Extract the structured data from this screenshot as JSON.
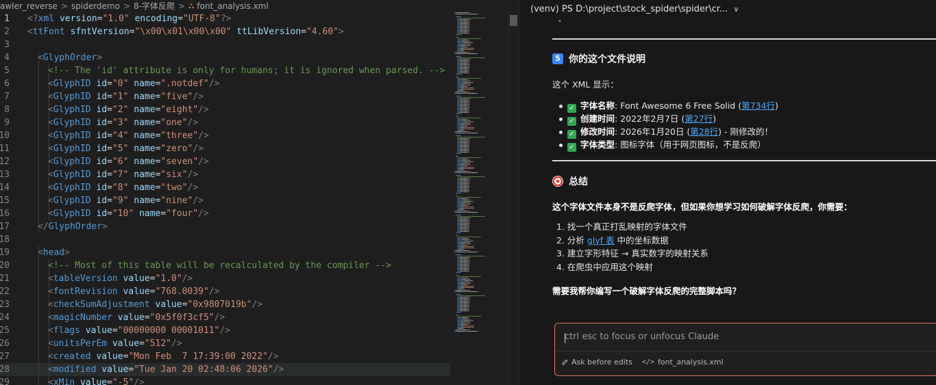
{
  "breadcrumb": {
    "items": [
      "awler_reverse",
      "spiderdemo",
      "8-字体反爬"
    ],
    "file_icon": "rss-icon",
    "file_name": "font_analysis.xml"
  },
  "editor": {
    "language": "xml",
    "current_line": 1,
    "lines": [
      {
        "n": "1",
        "indent": 0,
        "tokens": [
          [
            "punc",
            "<?"
          ],
          [
            "tag",
            "xml"
          ],
          [
            "text",
            " "
          ],
          [
            "attr",
            "version"
          ],
          [
            "text",
            "="
          ],
          [
            "str",
            "\"1.0\""
          ],
          [
            "text",
            " "
          ],
          [
            "attr",
            "encoding"
          ],
          [
            "text",
            "="
          ],
          [
            "str",
            "\"UTF-8\""
          ],
          [
            "punc",
            "?>"
          ]
        ]
      },
      {
        "n": "2",
        "indent": 0,
        "tokens": [
          [
            "punc",
            "<"
          ],
          [
            "tag",
            "ttFont"
          ],
          [
            "text",
            " "
          ],
          [
            "attr",
            "sfntVersion"
          ],
          [
            "text",
            "="
          ],
          [
            "str",
            "\"\\x00\\x01\\x00\\x00\""
          ],
          [
            "text",
            " "
          ],
          [
            "attr",
            "ttLibVersion"
          ],
          [
            "text",
            "="
          ],
          [
            "str",
            "\"4.60\""
          ],
          [
            "punc",
            ">"
          ]
        ]
      },
      {
        "n": "3",
        "indent": 0,
        "tokens": []
      },
      {
        "n": "4",
        "indent": 1,
        "tokens": [
          [
            "punc",
            "<"
          ],
          [
            "tag",
            "GlyphOrder"
          ],
          [
            "punc",
            ">"
          ]
        ]
      },
      {
        "n": "5",
        "indent": 2,
        "tokens": [
          [
            "cmt",
            "<!-- The 'id' attribute is only for humans; it is ignored when parsed. -->"
          ]
        ]
      },
      {
        "n": "6",
        "indent": 2,
        "tokens": [
          [
            "punc",
            "<"
          ],
          [
            "tag",
            "GlyphID"
          ],
          [
            "text",
            " "
          ],
          [
            "attr",
            "id"
          ],
          [
            "text",
            "="
          ],
          [
            "str",
            "\"0\""
          ],
          [
            "text",
            " "
          ],
          [
            "attr",
            "name"
          ],
          [
            "text",
            "="
          ],
          [
            "str",
            "\".notdef\""
          ],
          [
            "punc",
            "/>"
          ]
        ]
      },
      {
        "n": "7",
        "indent": 2,
        "tokens": [
          [
            "punc",
            "<"
          ],
          [
            "tag",
            "GlyphID"
          ],
          [
            "text",
            " "
          ],
          [
            "attr",
            "id"
          ],
          [
            "text",
            "="
          ],
          [
            "str",
            "\"1\""
          ],
          [
            "text",
            " "
          ],
          [
            "attr",
            "name"
          ],
          [
            "text",
            "="
          ],
          [
            "str",
            "\"five\""
          ],
          [
            "punc",
            "/>"
          ]
        ]
      },
      {
        "n": "8",
        "indent": 2,
        "tokens": [
          [
            "punc",
            "<"
          ],
          [
            "tag",
            "GlyphID"
          ],
          [
            "text",
            " "
          ],
          [
            "attr",
            "id"
          ],
          [
            "text",
            "="
          ],
          [
            "str",
            "\"2\""
          ],
          [
            "text",
            " "
          ],
          [
            "attr",
            "name"
          ],
          [
            "text",
            "="
          ],
          [
            "str",
            "\"eight\""
          ],
          [
            "punc",
            "/>"
          ]
        ]
      },
      {
        "n": "9",
        "indent": 2,
        "tokens": [
          [
            "punc",
            "<"
          ],
          [
            "tag",
            "GlyphID"
          ],
          [
            "text",
            " "
          ],
          [
            "attr",
            "id"
          ],
          [
            "text",
            "="
          ],
          [
            "str",
            "\"3\""
          ],
          [
            "text",
            " "
          ],
          [
            "attr",
            "name"
          ],
          [
            "text",
            "="
          ],
          [
            "str",
            "\"one\""
          ],
          [
            "punc",
            "/>"
          ]
        ]
      },
      {
        "n": "10",
        "indent": 2,
        "tokens": [
          [
            "punc",
            "<"
          ],
          [
            "tag",
            "GlyphID"
          ],
          [
            "text",
            " "
          ],
          [
            "attr",
            "id"
          ],
          [
            "text",
            "="
          ],
          [
            "str",
            "\"4\""
          ],
          [
            "text",
            " "
          ],
          [
            "attr",
            "name"
          ],
          [
            "text",
            "="
          ],
          [
            "str",
            "\"three\""
          ],
          [
            "punc",
            "/>"
          ]
        ]
      },
      {
        "n": "11",
        "indent": 2,
        "tokens": [
          [
            "punc",
            "<"
          ],
          [
            "tag",
            "GlyphID"
          ],
          [
            "text",
            " "
          ],
          [
            "attr",
            "id"
          ],
          [
            "text",
            "="
          ],
          [
            "str",
            "\"5\""
          ],
          [
            "text",
            " "
          ],
          [
            "attr",
            "name"
          ],
          [
            "text",
            "="
          ],
          [
            "str",
            "\"zero\""
          ],
          [
            "punc",
            "/>"
          ]
        ]
      },
      {
        "n": "12",
        "indent": 2,
        "tokens": [
          [
            "punc",
            "<"
          ],
          [
            "tag",
            "GlyphID"
          ],
          [
            "text",
            " "
          ],
          [
            "attr",
            "id"
          ],
          [
            "text",
            "="
          ],
          [
            "str",
            "\"6\""
          ],
          [
            "text",
            " "
          ],
          [
            "attr",
            "name"
          ],
          [
            "text",
            "="
          ],
          [
            "str",
            "\"seven\""
          ],
          [
            "punc",
            "/>"
          ]
        ]
      },
      {
        "n": "13",
        "indent": 2,
        "tokens": [
          [
            "punc",
            "<"
          ],
          [
            "tag",
            "GlyphID"
          ],
          [
            "text",
            " "
          ],
          [
            "attr",
            "id"
          ],
          [
            "text",
            "="
          ],
          [
            "str",
            "\"7\""
          ],
          [
            "text",
            " "
          ],
          [
            "attr",
            "name"
          ],
          [
            "text",
            "="
          ],
          [
            "str",
            "\"six\""
          ],
          [
            "punc",
            "/>"
          ]
        ]
      },
      {
        "n": "14",
        "indent": 2,
        "tokens": [
          [
            "punc",
            "<"
          ],
          [
            "tag",
            "GlyphID"
          ],
          [
            "text",
            " "
          ],
          [
            "attr",
            "id"
          ],
          [
            "text",
            "="
          ],
          [
            "str",
            "\"8\""
          ],
          [
            "text",
            " "
          ],
          [
            "attr",
            "name"
          ],
          [
            "text",
            "="
          ],
          [
            "str",
            "\"two\""
          ],
          [
            "punc",
            "/>"
          ]
        ]
      },
      {
        "n": "15",
        "indent": 2,
        "tokens": [
          [
            "punc",
            "<"
          ],
          [
            "tag",
            "GlyphID"
          ],
          [
            "text",
            " "
          ],
          [
            "attr",
            "id"
          ],
          [
            "text",
            "="
          ],
          [
            "str",
            "\"9\""
          ],
          [
            "text",
            " "
          ],
          [
            "attr",
            "name"
          ],
          [
            "text",
            "="
          ],
          [
            "str",
            "\"nine\""
          ],
          [
            "punc",
            "/>"
          ]
        ]
      },
      {
        "n": "16",
        "indent": 2,
        "tokens": [
          [
            "punc",
            "<"
          ],
          [
            "tag",
            "GlyphID"
          ],
          [
            "text",
            " "
          ],
          [
            "attr",
            "id"
          ],
          [
            "text",
            "="
          ],
          [
            "str",
            "\"10\""
          ],
          [
            "text",
            " "
          ],
          [
            "attr",
            "name"
          ],
          [
            "text",
            "="
          ],
          [
            "str",
            "\"four\""
          ],
          [
            "punc",
            "/>"
          ]
        ]
      },
      {
        "n": "17",
        "indent": 1,
        "tokens": [
          [
            "punc",
            "</"
          ],
          [
            "tag",
            "GlyphOrder"
          ],
          [
            "punc",
            ">"
          ]
        ]
      },
      {
        "n": "18",
        "indent": 0,
        "tokens": []
      },
      {
        "n": "19",
        "indent": 1,
        "tokens": [
          [
            "punc",
            "<"
          ],
          [
            "tag",
            "head"
          ],
          [
            "punc",
            ">"
          ]
        ]
      },
      {
        "n": "20",
        "indent": 2,
        "tokens": [
          [
            "cmt",
            "<!-- Most of this table will be recalculated by the compiler -->"
          ]
        ]
      },
      {
        "n": "21",
        "indent": 2,
        "tokens": [
          [
            "punc",
            "<"
          ],
          [
            "tag",
            "tableVersion"
          ],
          [
            "text",
            " "
          ],
          [
            "attr",
            "value"
          ],
          [
            "text",
            "="
          ],
          [
            "str",
            "\"1.0\""
          ],
          [
            "punc",
            "/>"
          ]
        ]
      },
      {
        "n": "22",
        "indent": 2,
        "tokens": [
          [
            "punc",
            "<"
          ],
          [
            "tag",
            "fontRevision"
          ],
          [
            "text",
            " "
          ],
          [
            "attr",
            "value"
          ],
          [
            "text",
            "="
          ],
          [
            "str",
            "\"768.0039\""
          ],
          [
            "punc",
            "/>"
          ]
        ]
      },
      {
        "n": "23",
        "indent": 2,
        "tokens": [
          [
            "punc",
            "<"
          ],
          [
            "tag",
            "checkSumAdjustment"
          ],
          [
            "text",
            " "
          ],
          [
            "attr",
            "value"
          ],
          [
            "text",
            "="
          ],
          [
            "str",
            "\"0x9807019b\""
          ],
          [
            "punc",
            "/>"
          ]
        ]
      },
      {
        "n": "24",
        "indent": 2,
        "tokens": [
          [
            "punc",
            "<"
          ],
          [
            "tag",
            "magicNumber"
          ],
          [
            "text",
            " "
          ],
          [
            "attr",
            "value"
          ],
          [
            "text",
            "="
          ],
          [
            "str",
            "\"0x5f0f3cf5\""
          ],
          [
            "punc",
            "/>"
          ]
        ]
      },
      {
        "n": "25",
        "indent": 2,
        "tokens": [
          [
            "punc",
            "<"
          ],
          [
            "tag",
            "flags"
          ],
          [
            "text",
            " "
          ],
          [
            "attr",
            "value"
          ],
          [
            "text",
            "="
          ],
          [
            "str",
            "\"00000000 00001011\""
          ],
          [
            "punc",
            "/>"
          ]
        ]
      },
      {
        "n": "26",
        "indent": 2,
        "tokens": [
          [
            "punc",
            "<"
          ],
          [
            "tag",
            "unitsPerEm"
          ],
          [
            "text",
            " "
          ],
          [
            "attr",
            "value"
          ],
          [
            "text",
            "="
          ],
          [
            "str",
            "\"512\""
          ],
          [
            "punc",
            "/>"
          ]
        ]
      },
      {
        "n": "27",
        "indent": 2,
        "tokens": [
          [
            "punc",
            "<"
          ],
          [
            "tag",
            "created"
          ],
          [
            "text",
            " "
          ],
          [
            "attr",
            "value"
          ],
          [
            "text",
            "="
          ],
          [
            "str",
            "\"Mon Feb  7 17:39:00 2022\""
          ],
          [
            "punc",
            "/>"
          ]
        ]
      },
      {
        "n": "28",
        "indent": 2,
        "tokens": [
          [
            "punc",
            "<"
          ],
          [
            "tag",
            "modified"
          ],
          [
            "text",
            " "
          ],
          [
            "attr",
            "value"
          ],
          [
            "text",
            "="
          ],
          [
            "str",
            "\"Tue Jan 20 02:48:06 2026\""
          ],
          [
            "punc",
            "/>"
          ]
        ]
      },
      {
        "n": "29",
        "indent": 2,
        "tokens": [
          [
            "punc",
            "<"
          ],
          [
            "tag",
            "xMin"
          ],
          [
            "text",
            " "
          ],
          [
            "attr",
            "value"
          ],
          [
            "text",
            "="
          ],
          [
            "str",
            "\"-5\""
          ],
          [
            "punc",
            "/>"
          ]
        ]
      }
    ]
  },
  "colors": {
    "punc": "#808080",
    "tag": "#569cd6",
    "attr": "#9cdcfe",
    "str": "#ce9178",
    "cmt": "#6a9955",
    "text": "#d4d4d4",
    "accent_border": "#e0745a",
    "link": "#4daafc",
    "check": "#2fa84f"
  },
  "panel": {
    "header_title": "(venv) PS D:\\project\\stock_spider\\spider\\cr...",
    "section1": {
      "icon": "keycap-5-icon",
      "icon_text": "5",
      "title": "你的这个文件说明",
      "intro": "这个 XML 显示：",
      "bullets": [
        {
          "label": "字体名称",
          "value_before": ": Font Awesome 6 Free Solid (",
          "link": "第734行",
          "value_after": ")"
        },
        {
          "label": "创建时间",
          "value_before": ": 2022年2月7日 (",
          "link": "第27行",
          "value_after": ")"
        },
        {
          "label": "修改时间",
          "value_before": ": 2026年1月20日 (",
          "link": "第28行",
          "value_after": ") - 刚修改的！"
        },
        {
          "label": "字体类型",
          "value_before": ": 图标字体（用于网页图标，不是反爬）",
          "link": "",
          "value_after": ""
        }
      ]
    },
    "section2": {
      "icon": "target-icon",
      "title": "总结",
      "summary": "这个字体文件本身不是反爬字体，但如果你想学习如何破解字体反爬，你需要：",
      "steps": [
        {
          "num": "1.",
          "before": "找一个真正打乱映射的字体文件",
          "link": "",
          "after": ""
        },
        {
          "num": "2.",
          "before": "分析 ",
          "link": "glyf 表",
          "after": " 中的坐标数据"
        },
        {
          "num": "3.",
          "before": "建立字形特征 → 真实数字的映射关系",
          "link": "",
          "after": ""
        },
        {
          "num": "4.",
          "before": "在爬虫中应用这个映射",
          "link": "",
          "after": ""
        }
      ],
      "question": "需要我帮你编写一个破解字体反爬的完整脚本吗？"
    },
    "input": {
      "placeholder": "ctrl esc to focus or unfocus Claude",
      "mode_icon": "pencil-icon",
      "mode_label": "Ask before edits",
      "file_icon": "code-icon",
      "file_label": "font_analysis.xml"
    }
  }
}
